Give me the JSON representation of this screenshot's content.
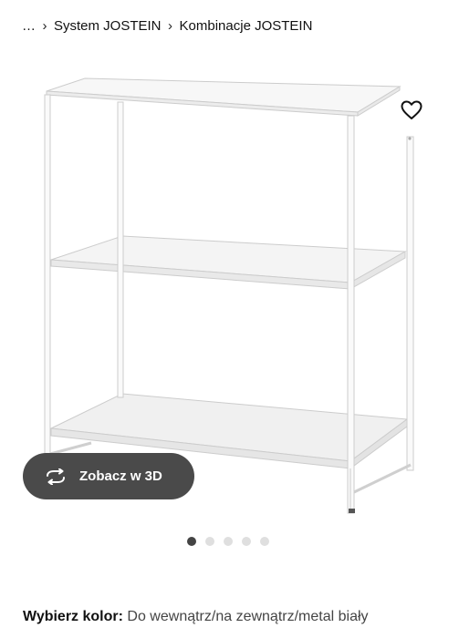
{
  "breadcrumb": {
    "ellipsis": "…",
    "items": [
      "System JOSTEIN",
      "Kombinacje JOSTEIN"
    ]
  },
  "product": {
    "image_alt": "JOSTEIN white metal shelving unit"
  },
  "actions": {
    "favorite_icon": "heart-icon",
    "view_3d_label": "Zobacz w 3D",
    "view_3d_icon": "rotate-arrows-icon"
  },
  "carousel": {
    "count": 5,
    "active_index": 0
  },
  "color": {
    "label": "Wybierz kolor:",
    "value": "Do wewnątrz/na zewnątrz/metal biały"
  },
  "colors": {
    "button_bg": "#4a4a4a",
    "dot_active": "#444444",
    "dot_inactive": "#dfdfdf"
  }
}
